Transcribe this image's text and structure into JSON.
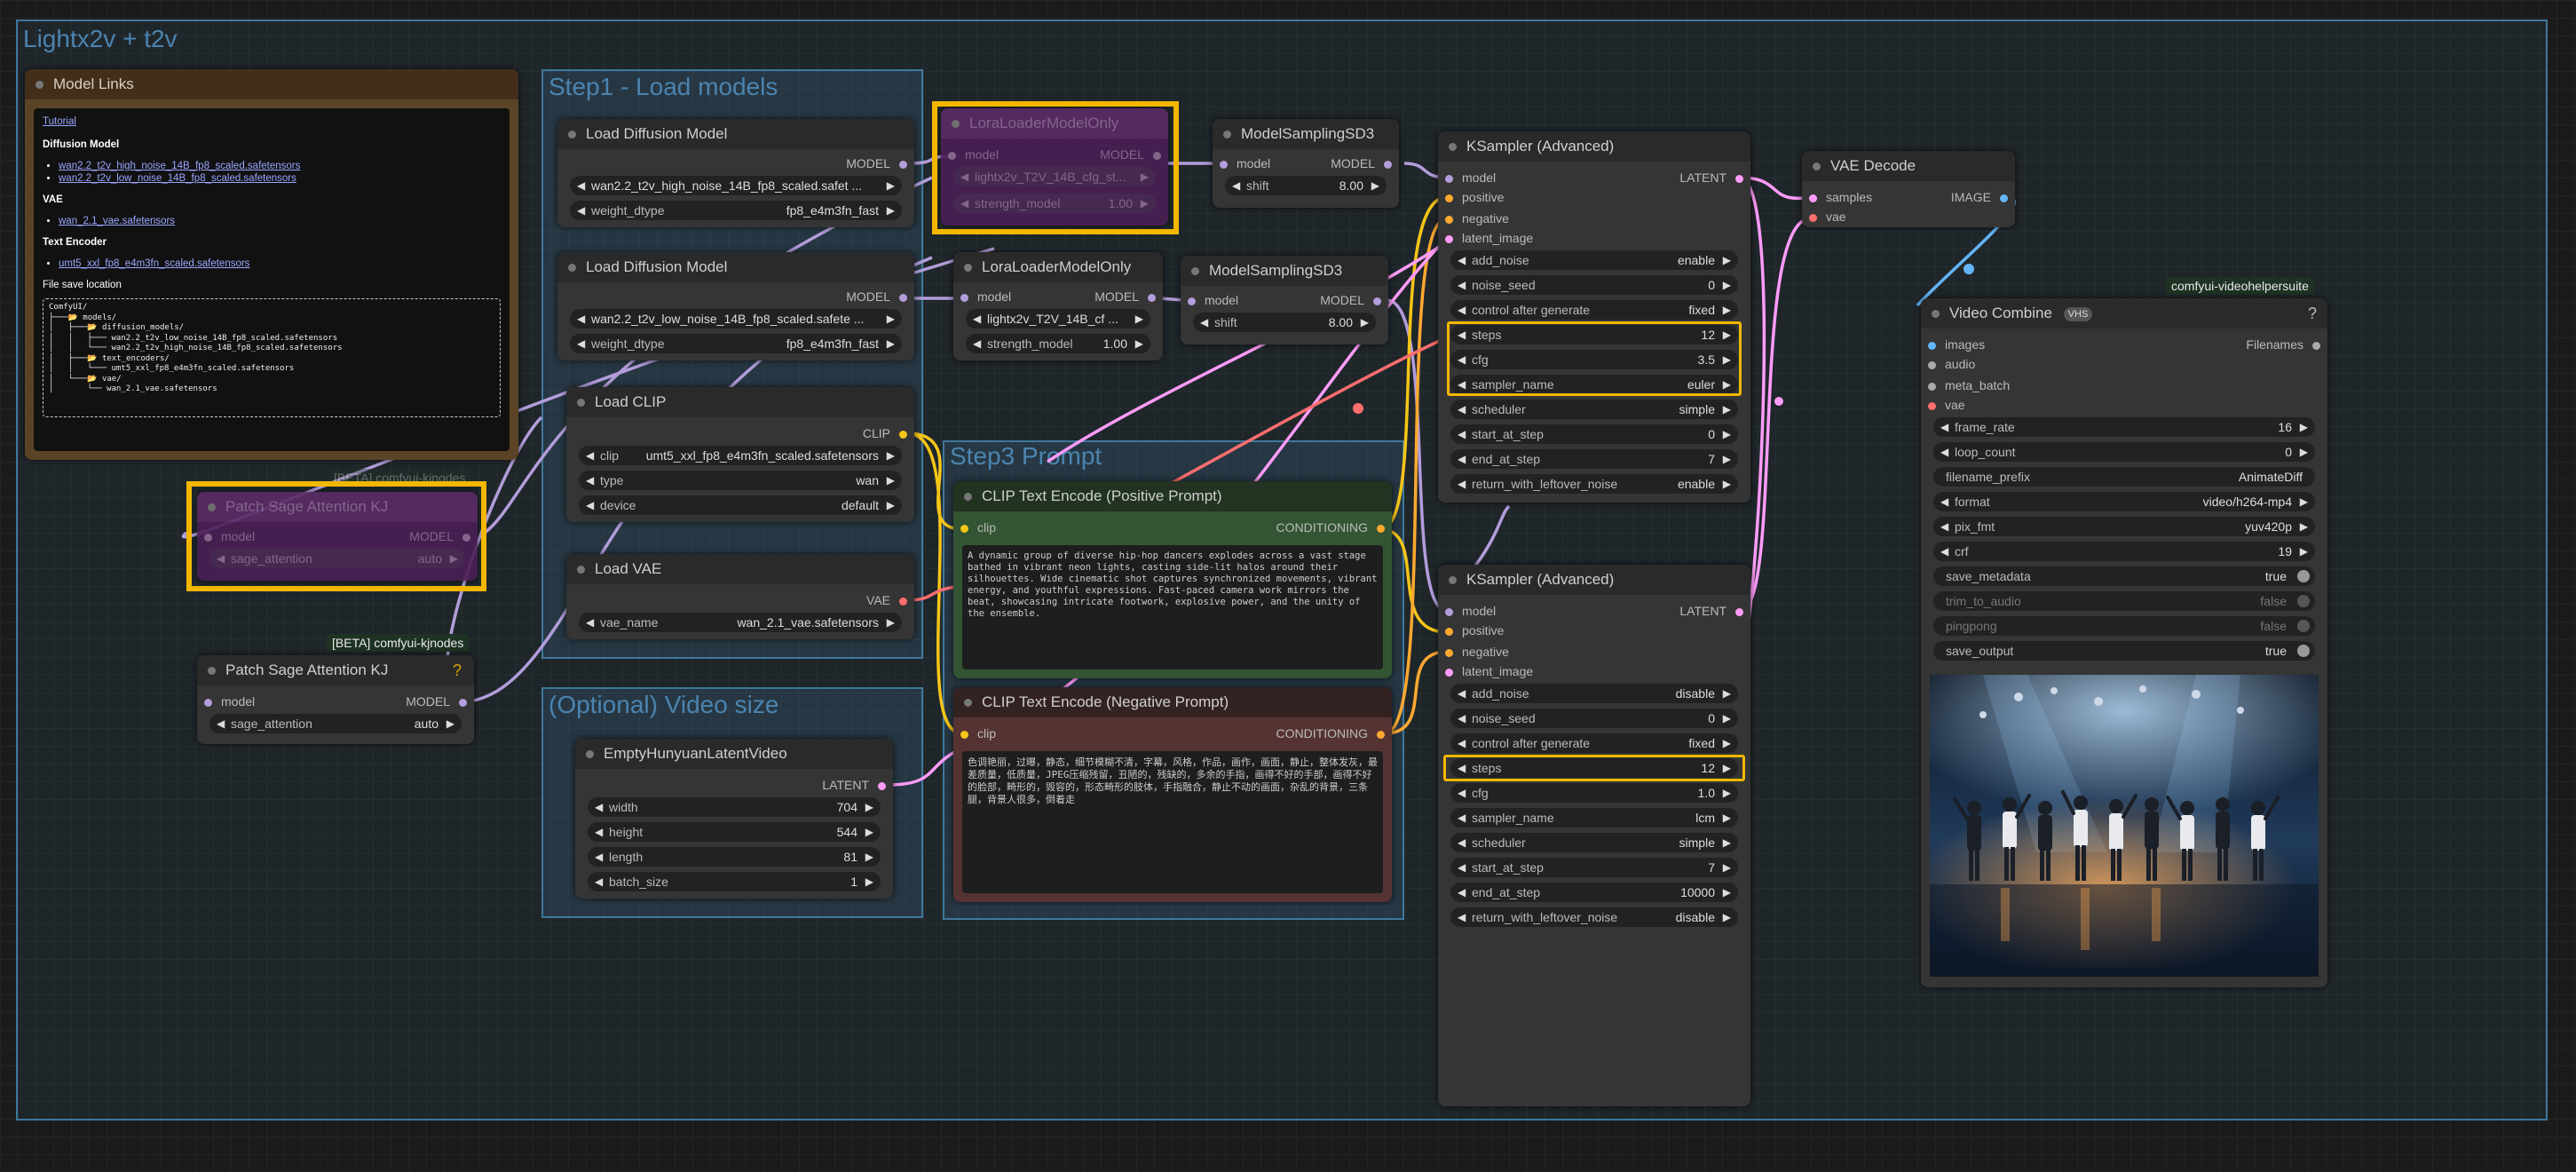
{
  "workflow_group": {
    "title": "Lightx2v + t2v"
  },
  "groups": {
    "step1": "Step1 - Load models",
    "step3": "Step3 Prompt",
    "video_size": "(Optional) Video size"
  },
  "model_links": {
    "title": "Model Links",
    "tutorial": "Tutorial",
    "diffusion_heading": "Diffusion Model",
    "diffusion_links": [
      "wan2.2_t2v_high_noise_14B_fp8_scaled.safetensors",
      "wan2.2_t2v_low_noise_14B_fp8_scaled.safetensors"
    ],
    "vae_heading": "VAE",
    "vae_links": [
      "wan_2.1_vae.safetensors"
    ],
    "te_heading": "Text Encoder",
    "te_links": [
      "umt5_xxl_fp8_e4m3fn_scaled.safetensors"
    ],
    "file_save": "File save location",
    "tree": "ComfyUI/\n├───📂 models/\n│   ├───📂 diffusion_models/\n│   │   ├─── wan2.2_t2v_low_noise_14B_fp8_scaled.safetensors\n│   │   └─── wan2.2_t2v_high_noise_14B_fp8_scaled.safetensors\n│   ├───📂 text_encoders/\n│   │   └─── umt5_xxl_fp8_e4m3fn_scaled.safetensors\n│   └───📂 vae/\n│       └── wan_2.1_vae.safetensors"
  },
  "load_diff_1": {
    "title": "Load Diffusion Model",
    "out": "MODEL",
    "unet": "wan2.2_t2v_high_noise_14B_fp8_scaled.safet ...",
    "dtype_label": "weight_dtype",
    "dtype": "fp8_e4m3fn_fast"
  },
  "load_diff_2": {
    "title": "Load Diffusion Model",
    "out": "MODEL",
    "unet": "wan2.2_t2v_low_noise_14B_fp8_scaled.safete ...",
    "dtype_label": "weight_dtype",
    "dtype": "fp8_e4m3fn_fast"
  },
  "lora_1": {
    "title": "LoraLoaderModelOnly",
    "in": "model",
    "out": "MODEL",
    "lora": "lightx2v_T2V_14B_cfg_st...",
    "strength_label": "strength_model",
    "strength": "1.00"
  },
  "lora_2": {
    "title": "LoraLoaderModelOnly",
    "in": "model",
    "out": "MODEL",
    "lora": "lightx2v_T2V_14B_cf ...",
    "strength_label": "strength_model",
    "strength": "1.00"
  },
  "msd3_1": {
    "title": "ModelSamplingSD3",
    "in": "model",
    "out": "MODEL",
    "shift_label": "shift",
    "shift": "8.00"
  },
  "msd3_2": {
    "title": "ModelSamplingSD3",
    "in": "model",
    "out": "MODEL",
    "shift_label": "shift",
    "shift": "8.00"
  },
  "load_clip": {
    "title": "Load CLIP",
    "out": "CLIP",
    "clip_label": "clip",
    "clip": "umt5_xxl_fp8_e4m3fn_scaled.safetensors",
    "type_label": "type",
    "type": "wan",
    "device_label": "device",
    "device": "default"
  },
  "load_vae": {
    "title": "Load VAE",
    "out": "VAE",
    "vae_label": "vae_name",
    "vae": "wan_2.1_vae.safetensors"
  },
  "patch_1": {
    "badge": "[BETA] comfyui-kjnodes",
    "title": "Patch Sage Attention KJ",
    "in": "model",
    "out": "MODEL",
    "sage_label": "sage_attention",
    "sage": "auto"
  },
  "patch_2": {
    "badge": "[BETA] comfyui-kjnodes",
    "title": "Patch Sage Attention KJ",
    "in": "model",
    "out": "MODEL",
    "sage_label": "sage_attention",
    "sage": "auto"
  },
  "latent": {
    "title": "EmptyHunyuanLatentVideo",
    "out": "LATENT",
    "fields": [
      {
        "label": "width",
        "value": "704"
      },
      {
        "label": "height",
        "value": "544"
      },
      {
        "label": "length",
        "value": "81"
      },
      {
        "label": "batch_size",
        "value": "1"
      }
    ]
  },
  "pos": {
    "title": "CLIP Text Encode (Positive Prompt)",
    "in": "clip",
    "out": "CONDITIONING",
    "text": "A dynamic group of diverse hip-hop dancers explodes across a vast stage bathed in vibrant neon lights, casting side-lit halos around their silhouettes. Wide cinematic shot captures synchronized movements, vibrant energy, and youthful expressions. Fast-paced camera work mirrors the beat, showcasing intricate footwork, explosive power, and the unity of the ensemble."
  },
  "neg": {
    "title": "CLIP Text Encode (Negative Prompt)",
    "in": "clip",
    "out": "CONDITIONING",
    "text": "色调艳丽，过曝，静态，细节模糊不清，字幕，风格，作品，画作，画面，静止，整体发灰，最差质量，低质量，JPEG压缩残留，丑陋的，残缺的，多余的手指，画得不好的手部，画得不好的脸部，畸形的，毁容的，形态畸形的肢体，手指融合，静止不动的画面，杂乱的背景，三条腿，背景人很多，倒着走"
  },
  "ks1": {
    "title": "KSampler (Advanced)",
    "out": "LATENT",
    "inputs": [
      "model",
      "positive",
      "negative",
      "latent_image"
    ],
    "fields": [
      {
        "label": "add_noise",
        "value": "enable"
      },
      {
        "label": "noise_seed",
        "value": "0"
      },
      {
        "label": "control after generate",
        "value": "fixed"
      },
      {
        "label": "steps",
        "value": "12"
      },
      {
        "label": "cfg",
        "value": "3.5"
      },
      {
        "label": "sampler_name",
        "value": "euler"
      },
      {
        "label": "scheduler",
        "value": "simple"
      },
      {
        "label": "start_at_step",
        "value": "0"
      },
      {
        "label": "end_at_step",
        "value": "7"
      },
      {
        "label": "return_with_leftover_noise",
        "value": "enable"
      }
    ]
  },
  "ks2": {
    "title": "KSampler (Advanced)",
    "out": "LATENT",
    "inputs": [
      "model",
      "positive",
      "negative",
      "latent_image"
    ],
    "fields": [
      {
        "label": "add_noise",
        "value": "disable"
      },
      {
        "label": "noise_seed",
        "value": "0"
      },
      {
        "label": "control after generate",
        "value": "fixed"
      },
      {
        "label": "steps",
        "value": "12"
      },
      {
        "label": "cfg",
        "value": "1.0"
      },
      {
        "label": "sampler_name",
        "value": "lcm"
      },
      {
        "label": "scheduler",
        "value": "simple"
      },
      {
        "label": "start_at_step",
        "value": "7"
      },
      {
        "label": "end_at_step",
        "value": "10000"
      },
      {
        "label": "return_with_leftover_noise",
        "value": "disable"
      }
    ]
  },
  "vae_decode": {
    "title": "VAE Decode",
    "inputs": [
      "samples",
      "vae"
    ],
    "out": "IMAGE"
  },
  "video_combine": {
    "badge": "comfyui-videohelpersuite",
    "title": "Video Combine",
    "vhs": "VHS",
    "out": "Filenames",
    "inputs": [
      "images",
      "audio",
      "meta_batch",
      "vae"
    ],
    "fields": [
      {
        "label": "frame_rate",
        "value": "16"
      },
      {
        "label": "loop_count",
        "value": "0"
      }
    ],
    "prefix_label": "filename_prefix",
    "prefix": "AnimateDiff",
    "fields2": [
      {
        "label": "format",
        "value": "video/h264-mp4"
      },
      {
        "label": "pix_fmt",
        "value": "yuv420p"
      },
      {
        "label": "crf",
        "value": "19"
      }
    ],
    "toggles": [
      {
        "label": "save_metadata",
        "value": "true",
        "on": true
      },
      {
        "label": "trim_to_audio",
        "value": "false",
        "on": false
      },
      {
        "label": "pingpong",
        "value": "false",
        "on": false
      },
      {
        "label": "save_output",
        "value": "true",
        "on": true
      }
    ]
  },
  "colors": {
    "model": "#b39ddb",
    "clip": "#f5c518",
    "vae": "#ff6e6e",
    "cond": "#ffa931",
    "latent": "#ff9cf9",
    "image": "#64b5f6"
  }
}
